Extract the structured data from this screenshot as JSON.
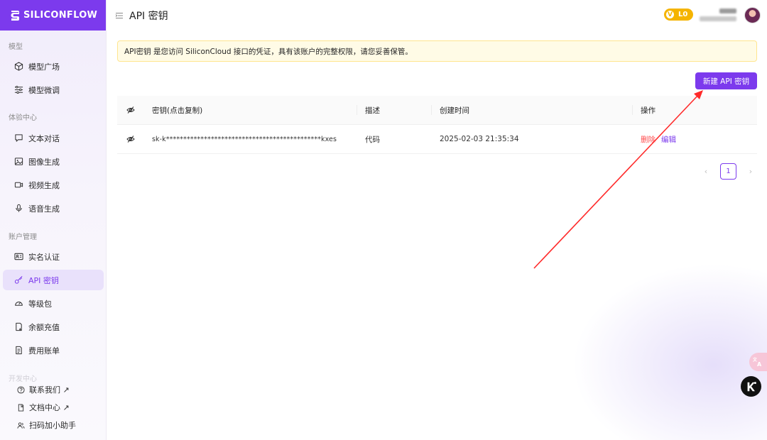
{
  "brand": {
    "name": "SILICONFLOW"
  },
  "header": {
    "title": "API 密钥",
    "level_badge": "L0",
    "level_letter": "V"
  },
  "sidebar": {
    "sections": [
      {
        "title": "模型"
      },
      {
        "title": "体验中心"
      },
      {
        "title": "账户管理"
      },
      {
        "title": "开发中心"
      }
    ],
    "items": [
      {
        "label": "模型广场",
        "icon": "cube-icon"
      },
      {
        "label": "模型微调",
        "icon": "sliders-icon"
      },
      {
        "label": "文本对话",
        "icon": "chat-icon"
      },
      {
        "label": "图像生成",
        "icon": "image-icon"
      },
      {
        "label": "视频生成",
        "icon": "video-icon"
      },
      {
        "label": "语音生成",
        "icon": "mic-icon"
      },
      {
        "label": "实名认证",
        "icon": "id-card-icon"
      },
      {
        "label": "API 密钥",
        "icon": "key-icon",
        "active": true
      },
      {
        "label": "等级包",
        "icon": "gauge-icon"
      },
      {
        "label": "余额充值",
        "icon": "recharge-icon"
      },
      {
        "label": "费用账单",
        "icon": "bill-icon"
      }
    ],
    "bottom_items": [
      {
        "label": "联系我们 ↗",
        "icon": "help-icon"
      },
      {
        "label": "文档中心 ↗",
        "icon": "document-icon"
      },
      {
        "label": "扫码加小助手",
        "icon": "people-icon"
      }
    ]
  },
  "notice": {
    "text": "API密钥 是您访问 SiliconCloud 接口的凭证，具有该账户的完整权限，请您妥善保管。"
  },
  "toolbar": {
    "new_key_label": "新建 API 密钥"
  },
  "table": {
    "columns": [
      "密钥(点击复制)",
      "描述",
      "创建时间",
      "操作"
    ],
    "rows": [
      {
        "key": "sk-k*********************************************kxes",
        "description": "代码",
        "created_at": "2025-02-03 21:35:34",
        "actions": {
          "delete": "删除",
          "edit": "编辑"
        }
      }
    ]
  },
  "pagination": {
    "current": "1",
    "prev": "‹",
    "next": "›"
  },
  "colors": {
    "accent": "#7c3aed",
    "danger": "#ff4d4f",
    "notice_bg": "#fffbe6",
    "badge": "#f5b400",
    "annotation_arrow": "#ff2a2a"
  }
}
